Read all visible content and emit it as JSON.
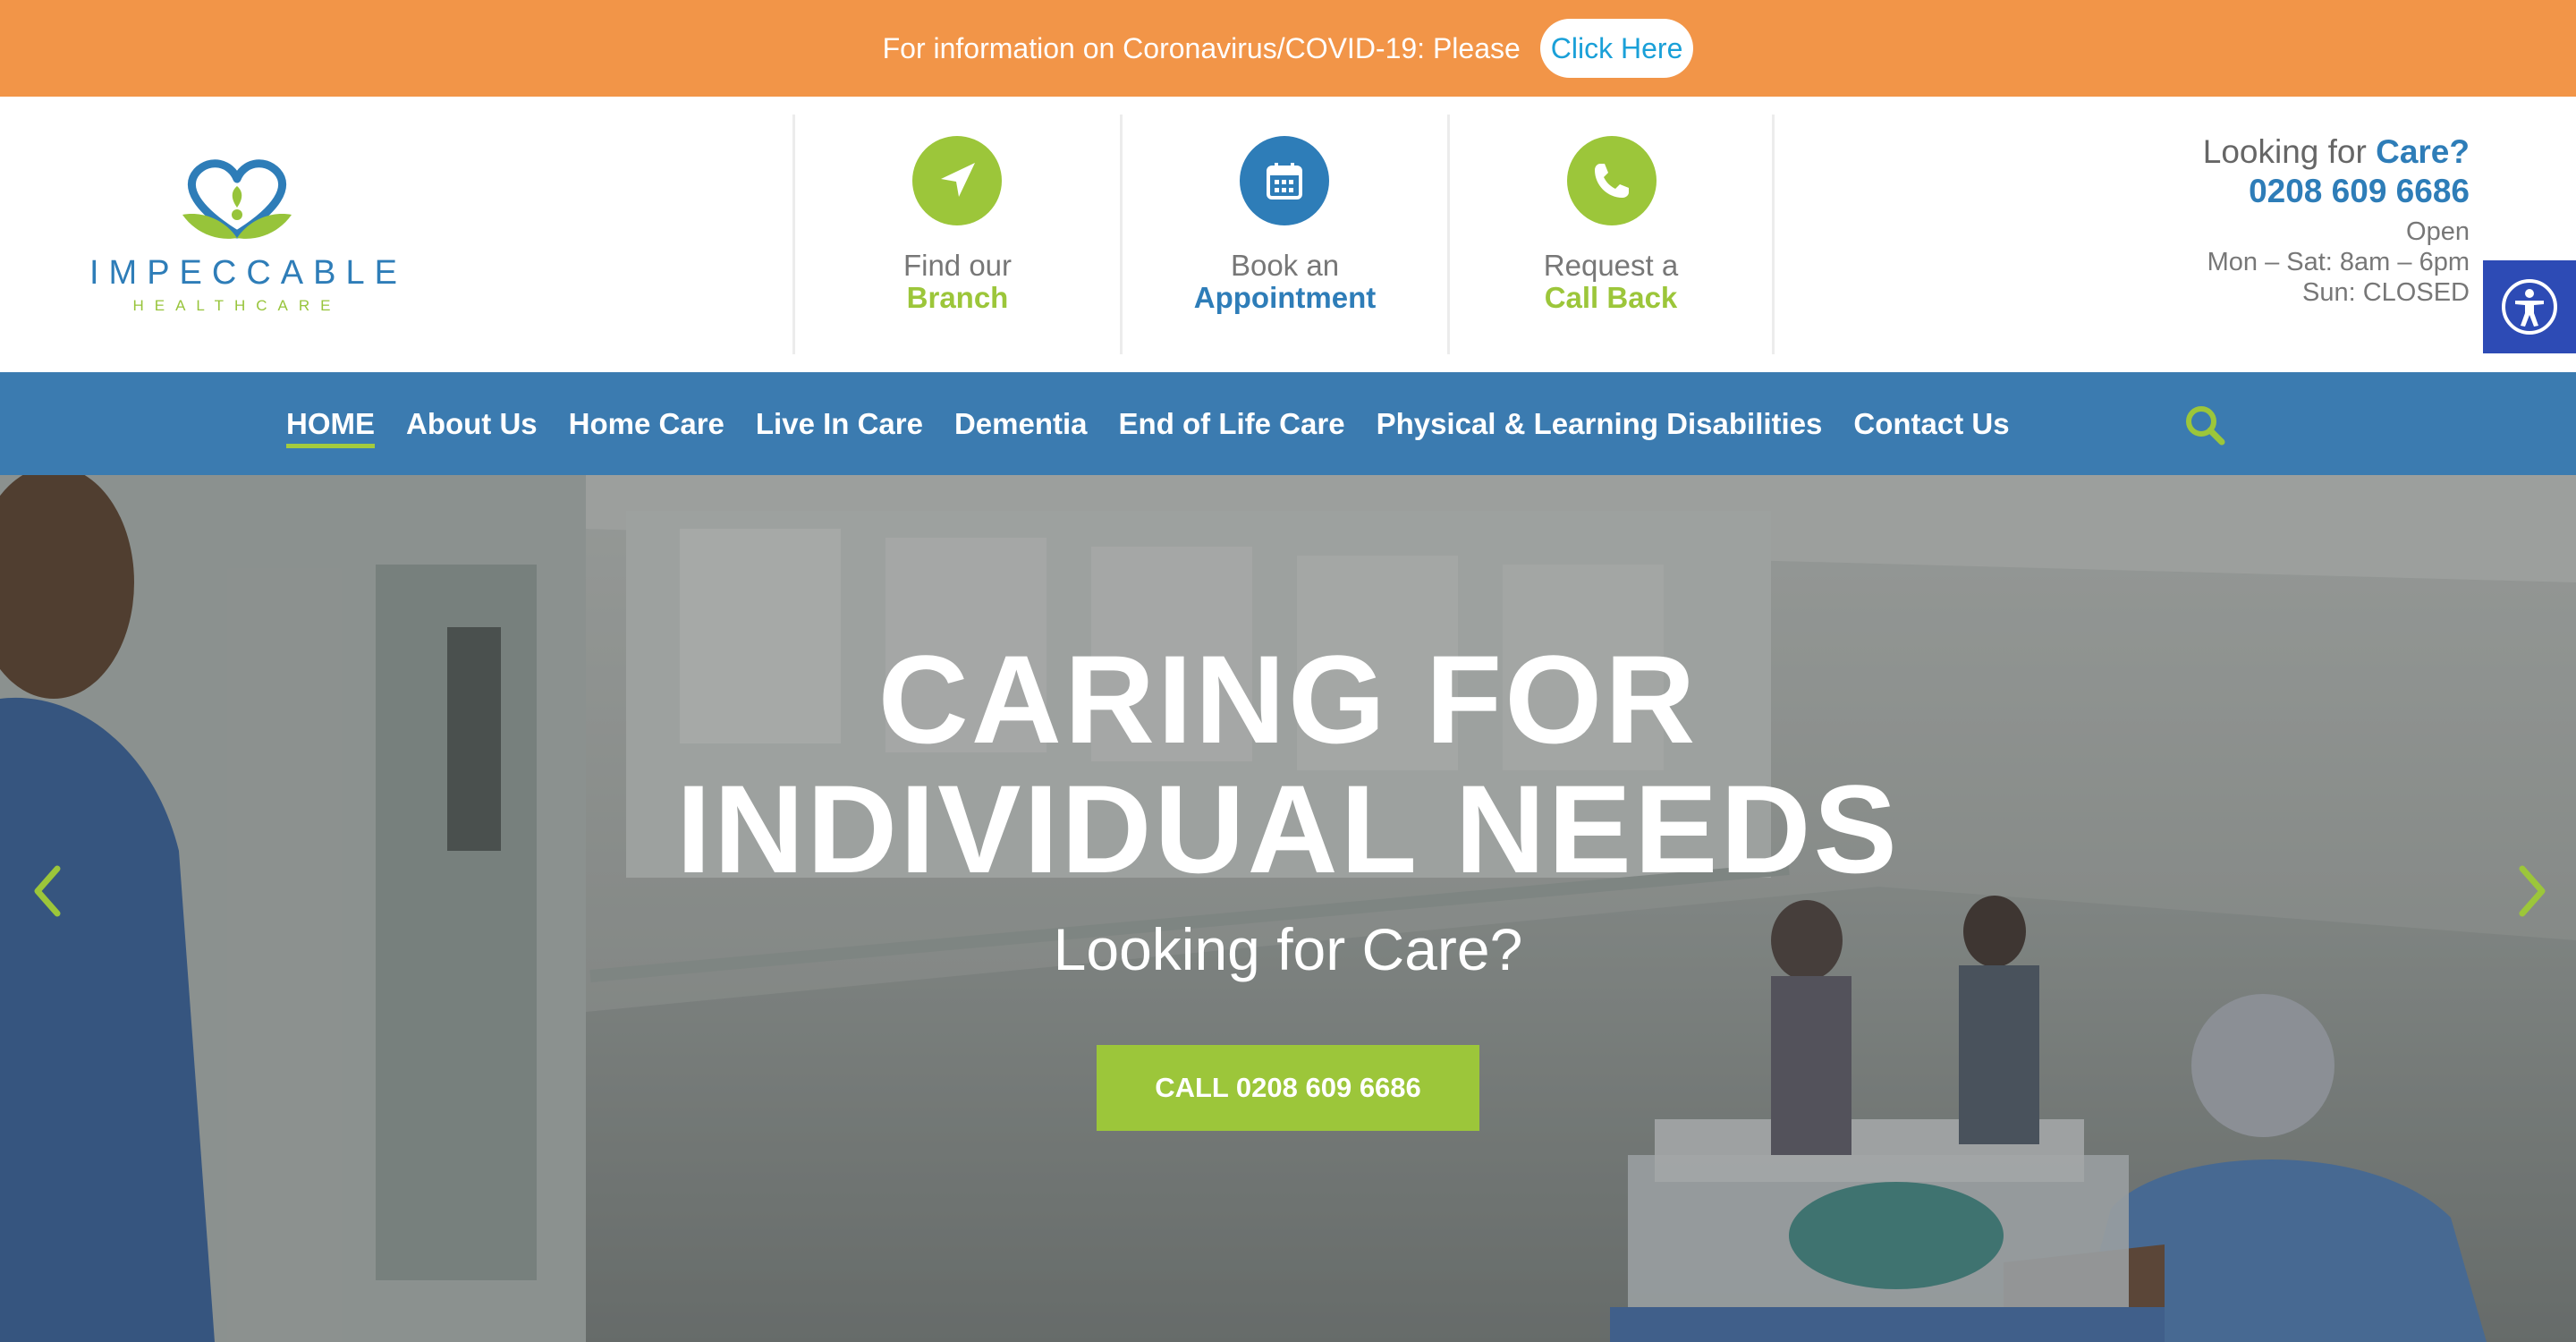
{
  "topbar": {
    "text": "For information on Coronavirus/COVID-19: Please",
    "button": "Click Here"
  },
  "logo": {
    "title": "IMPECCABLE",
    "subtitle": "HEALTHCARE"
  },
  "ctas": [
    {
      "line1": "Find our",
      "line2": "Branch",
      "icon": "navigation-arrow-icon",
      "color": "#9cc63a"
    },
    {
      "line1": "Book an",
      "line2": "Appointment",
      "icon": "calendar-icon",
      "color": "#2e7db8"
    },
    {
      "line1": "Request a",
      "line2": "Call Back",
      "icon": "phone-icon",
      "color": "#9cc63a"
    }
  ],
  "contact": {
    "looking_prefix": "Looking for ",
    "looking_bold": "Care?",
    "phone": "0208 609 6686",
    "open": "Open",
    "hours_weekday": "Mon – Sat: 8am – 6pm",
    "hours_sunday": "Sun: CLOSED"
  },
  "nav": {
    "items": [
      "HOME",
      "About Us",
      "Home Care",
      "Live In Care",
      "Dementia",
      "End of Life Care",
      "Physical & Learning Disabilities",
      "Contact Us"
    ],
    "active": "HOME"
  },
  "hero": {
    "title_line1": "CARING FOR",
    "title_line2": "INDIVIDUAL NEEDS",
    "subtitle": "Looking for Care?",
    "button": "CALL 0208 609 6686"
  },
  "colors": {
    "orange": "#f29548",
    "blue": "#2e7db8",
    "nav_blue": "#3b7bb0",
    "green": "#9cc63a",
    "accessibility": "#2d4bb5"
  }
}
